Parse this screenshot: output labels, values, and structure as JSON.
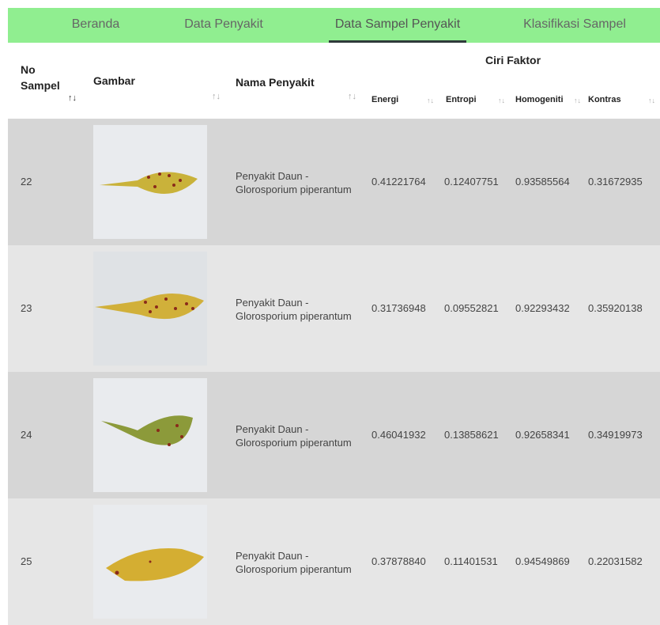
{
  "nav": {
    "items": [
      {
        "label": "Beranda"
      },
      {
        "label": "Data Penyakit"
      },
      {
        "label": "Data Sampel Penyakit"
      },
      {
        "label": "Klasifikasi Sampel"
      }
    ]
  },
  "table": {
    "headers": {
      "no_sampel": "No Sampel",
      "gambar": "Gambar",
      "nama_penyakit": "Nama Penyakit",
      "ciri_faktor": "Ciri Faktor",
      "energi": "Energi",
      "entropi": "Entropi",
      "homogeniti": "Homogeniti",
      "kontras": "Kontras",
      "sort_symbol": "↑↓"
    },
    "rows": [
      {
        "no": "22",
        "nama_line1": "Penyakit Daun -",
        "nama_line2": "Glorosporium piperantum",
        "energi": "0.41221764",
        "entropi": "0.12407751",
        "homogeniti": "0.93585564",
        "kontras": "0.31672935",
        "leaf_color": "#c9b23a"
      },
      {
        "no": "23",
        "nama_line1": "Penyakit Daun -",
        "nama_line2": "Glorosporium piperantum",
        "energi": "0.31736948",
        "entropi": "0.09552821",
        "homogeniti": "0.92293432",
        "kontras": "0.35920138",
        "leaf_color": "#d1b03a"
      },
      {
        "no": "24",
        "nama_line1": "Penyakit Daun -",
        "nama_line2": "Glorosporium piperantum",
        "energi": "0.46041932",
        "entropi": "0.13858621",
        "homogeniti": "0.92658341",
        "kontras": "0.34919973",
        "leaf_color": "#8c9a3a"
      },
      {
        "no": "25",
        "nama_line1": "Penyakit Daun -",
        "nama_line2": "Glorosporium piperantum",
        "energi": "0.37878840",
        "entropi": "0.11401531",
        "homogeniti": "0.94549869",
        "kontras": "0.22031582",
        "leaf_color": "#d4ae32"
      }
    ]
  }
}
